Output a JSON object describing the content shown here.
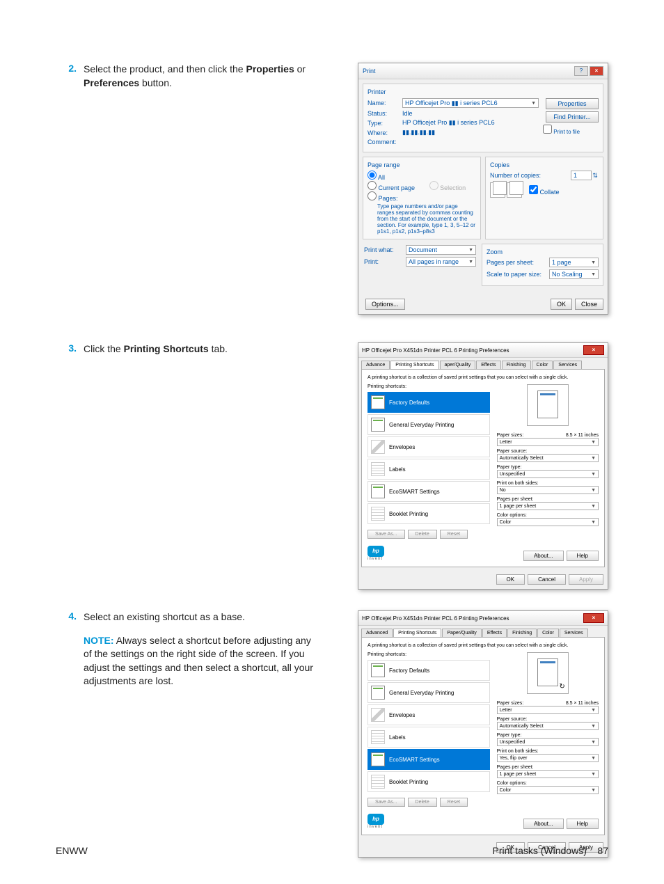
{
  "steps": {
    "s2": {
      "num": "2.",
      "textA": "Select the product, and then click the ",
      "boldA": "Properties",
      "textB": " or ",
      "boldB": "Preferences",
      "textC": " button."
    },
    "s3": {
      "num": "3.",
      "textA": "Click the ",
      "boldA": "Printing Shortcuts",
      "textB": " tab."
    },
    "s4": {
      "num": "4.",
      "text": "Select an existing shortcut as a base.",
      "noteLabel": "NOTE:",
      "noteText": "Always select a shortcut before adjusting any of the settings on the right side of the screen. If you adjust the settings and then select a shortcut, all your adjustments are lost."
    }
  },
  "dlg1": {
    "title": "Print",
    "printerHeader": "Printer",
    "name_label": "Name:",
    "name_value": "HP Officejet Pro ▮▮ i series PCL6",
    "status_label": "Status:",
    "status_value": "Idle",
    "type_label": "Type:",
    "type_value": "HP Officejet Pro ▮▮ i series PCL6",
    "where_label": "Where:",
    "where_value": "▮▮.▮▮.▮▮.▮▮",
    "comment_label": "Comment:",
    "properties_btn": "Properties",
    "find_printer_btn": "Find Printer...",
    "print_to_file": "Print to file",
    "page_range": "Page range",
    "all": "All",
    "current_page": "Current page",
    "selection": "Selection",
    "pages": "Pages:",
    "help": "Type page numbers and/or page ranges separated by commas counting from the start of the document or the section. For example, type 1, 3, 5–12 or p1s1, p1s2, p1s3–p8s3",
    "copies": "Copies",
    "num_copies_label": "Number of copies:",
    "num_copies": "1",
    "collate": "Collate",
    "print_what_label": "Print what:",
    "print_what": "Document",
    "print_label": "Print:",
    "print": "All pages in range",
    "zoom": "Zoom",
    "pps_label": "Pages per sheet:",
    "pps": "1 page",
    "scale_label": "Scale to paper size:",
    "scale": "No Scaling",
    "options_btn": "Options...",
    "ok_btn": "OK",
    "close_btn": "Close"
  },
  "dlg2": {
    "title": "HP Officejet Pro X451dn Printer PCL 6 Printing Preferences",
    "tabs": [
      "Advance",
      "Printing Shortcuts",
      "aper/Quality",
      "Effects",
      "Finishing",
      "Color",
      "Services"
    ],
    "tabs3": [
      "Advanced",
      "Printing Shortcuts",
      "Paper/Quality",
      "Effects",
      "Finishing",
      "Color",
      "Services"
    ],
    "desc": "A printing shortcut is a collection of saved print settings that you can select with a single click.",
    "shortcuts_label": "Printing shortcuts:",
    "shortcuts": [
      "Factory Defaults",
      "General Everyday Printing",
      "Envelopes",
      "Labels",
      "EcoSMART Settings",
      "Booklet Printing"
    ],
    "paper_sizes_label": "Paper sizes:",
    "paper_sizes_dim": "8.5 × 11 inches",
    "paper_sizes": "Letter",
    "paper_source_label": "Paper source:",
    "paper_source": "Automatically Select",
    "paper_type_label": "Paper type:",
    "paper_type": "Unspecified",
    "both_sides_label": "Print on both sides:",
    "both_sides_no": "No",
    "both_sides_yes": "Yes, flip over",
    "pps_label": "Pages per sheet:",
    "pps": "1 page per sheet",
    "color_label": "Color options:",
    "color": "Color",
    "save_as": "Save As...",
    "delete": "Delete",
    "reset": "Reset",
    "about": "About...",
    "help": "Help",
    "ok": "OK",
    "cancel": "Cancel",
    "apply": "Apply",
    "invent": "invent"
  },
  "footer": {
    "left": "ENWW",
    "right_text": "Print tasks (Windows)",
    "right_num": "87"
  }
}
